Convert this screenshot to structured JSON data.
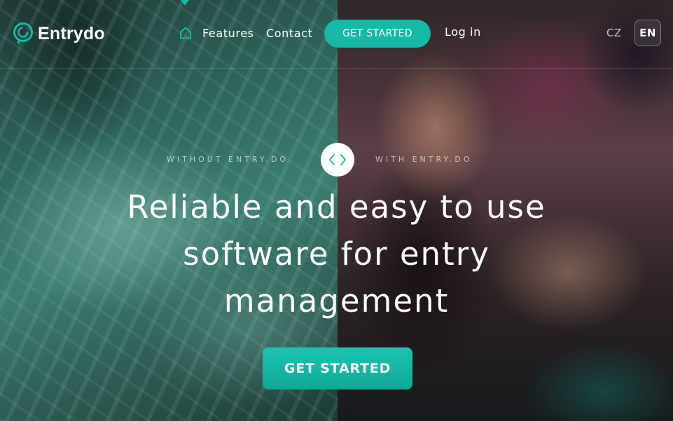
{
  "brand": {
    "name": "Entrydo",
    "logo_icon": "entrydo-swirl-logo",
    "accent_color": "#16b8a6"
  },
  "nav": {
    "home_icon": "home-icon",
    "features_label": "Features",
    "contact_label": "Contact",
    "cta_label": "GET STARTED",
    "login_label": "Log in"
  },
  "language": {
    "options": [
      "CZ",
      "EN"
    ],
    "selected": "EN"
  },
  "comparison": {
    "left_label": "WITHOUT ENTRY.DO",
    "right_label": "WITH ENTRY.DO",
    "handle_icon": "left-right-chevrons-icon"
  },
  "hero": {
    "title": "Reliable and easy to use software for entry management",
    "cta_label": "GET STARTED"
  }
}
